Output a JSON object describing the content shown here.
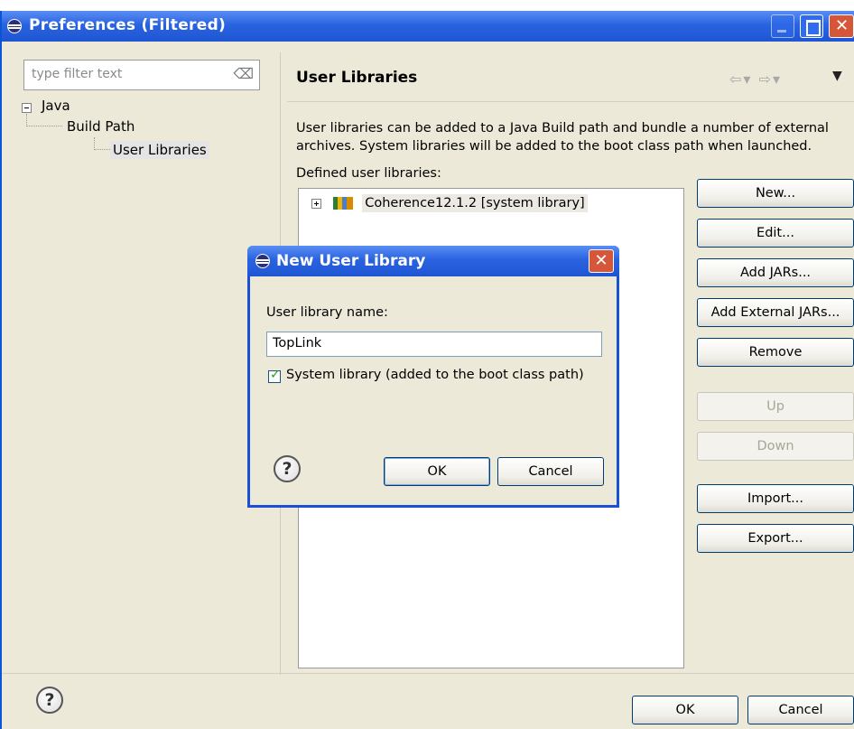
{
  "window": {
    "title": "Preferences (Filtered)"
  },
  "sidebar": {
    "filter_placeholder": "type filter text",
    "tree": [
      {
        "label": "Java",
        "level": 0,
        "expanded": true
      },
      {
        "label": "Build Path",
        "level": 1,
        "expanded": true
      },
      {
        "label": "User Libraries",
        "level": 2,
        "selected": true
      }
    ]
  },
  "page": {
    "title": "User Libraries",
    "description": "User libraries can be added to a Java Build path and bundle a number of external archives. System libraries will be added to the boot class path when launched.",
    "defined_label": "Defined user libraries:",
    "libraries": [
      {
        "label": "Coherence12.1.2 [system library]",
        "expanded": false
      }
    ],
    "buttons": {
      "new": "New...",
      "edit": "Edit...",
      "add_jars": "Add JARs...",
      "add_external_jars": "Add External JARs...",
      "remove": "Remove",
      "up": "Up",
      "down": "Down",
      "import": "Import...",
      "export": "Export..."
    }
  },
  "footer": {
    "ok": "OK",
    "cancel": "Cancel"
  },
  "dialog": {
    "title": "New User Library",
    "name_label": "User library name:",
    "name_value": "TopLink",
    "system_library_label": "System library (added to the boot class path)",
    "system_library_checked": true,
    "ok": "OK",
    "cancel": "Cancel"
  },
  "icons": {
    "help": "?"
  },
  "colors": {
    "titlebar": "#2a63e0",
    "close": "#d6563a",
    "window_bg": "#ece9d8"
  }
}
